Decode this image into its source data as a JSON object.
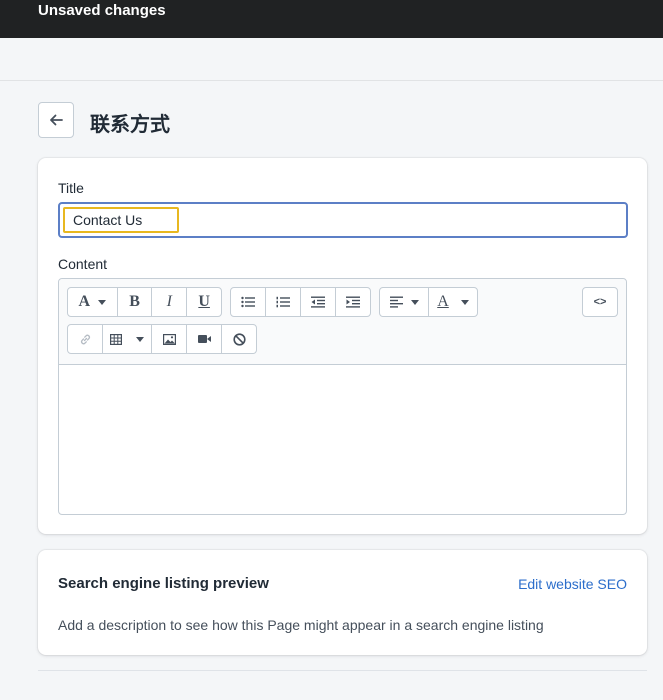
{
  "topbar": {
    "title": "Unsaved changes"
  },
  "page": {
    "title": "联系方式",
    "back_icon": "arrow-left-icon"
  },
  "form": {
    "title_label": "Title",
    "title_value": "Contact Us",
    "content_label": "Content"
  },
  "toolbar": {
    "row1": [
      "font-icon",
      "bold-icon",
      "italic-icon",
      "underline-icon",
      "bullet-list-icon",
      "numbered-list-icon",
      "outdent-icon",
      "indent-icon",
      "align-icon",
      "text-color-icon",
      "code-view-icon"
    ],
    "row2": [
      "link-icon",
      "table-icon",
      "image-icon",
      "video-icon",
      "clear-format-icon"
    ],
    "font_glyph": "A",
    "bold_glyph": "B",
    "italic_glyph": "I",
    "underline_glyph": "U",
    "color_glyph": "A",
    "code_glyph": "<>"
  },
  "seo": {
    "title": "Search engine listing preview",
    "edit_link": "Edit website SEO",
    "description": "Add a description to see how this Page might appear in a search engine listing"
  },
  "colors": {
    "topbar_bg": "#202223",
    "focus_border": "#5c7fc6",
    "highlight": "#e8b820",
    "link": "#2c6ecb"
  }
}
